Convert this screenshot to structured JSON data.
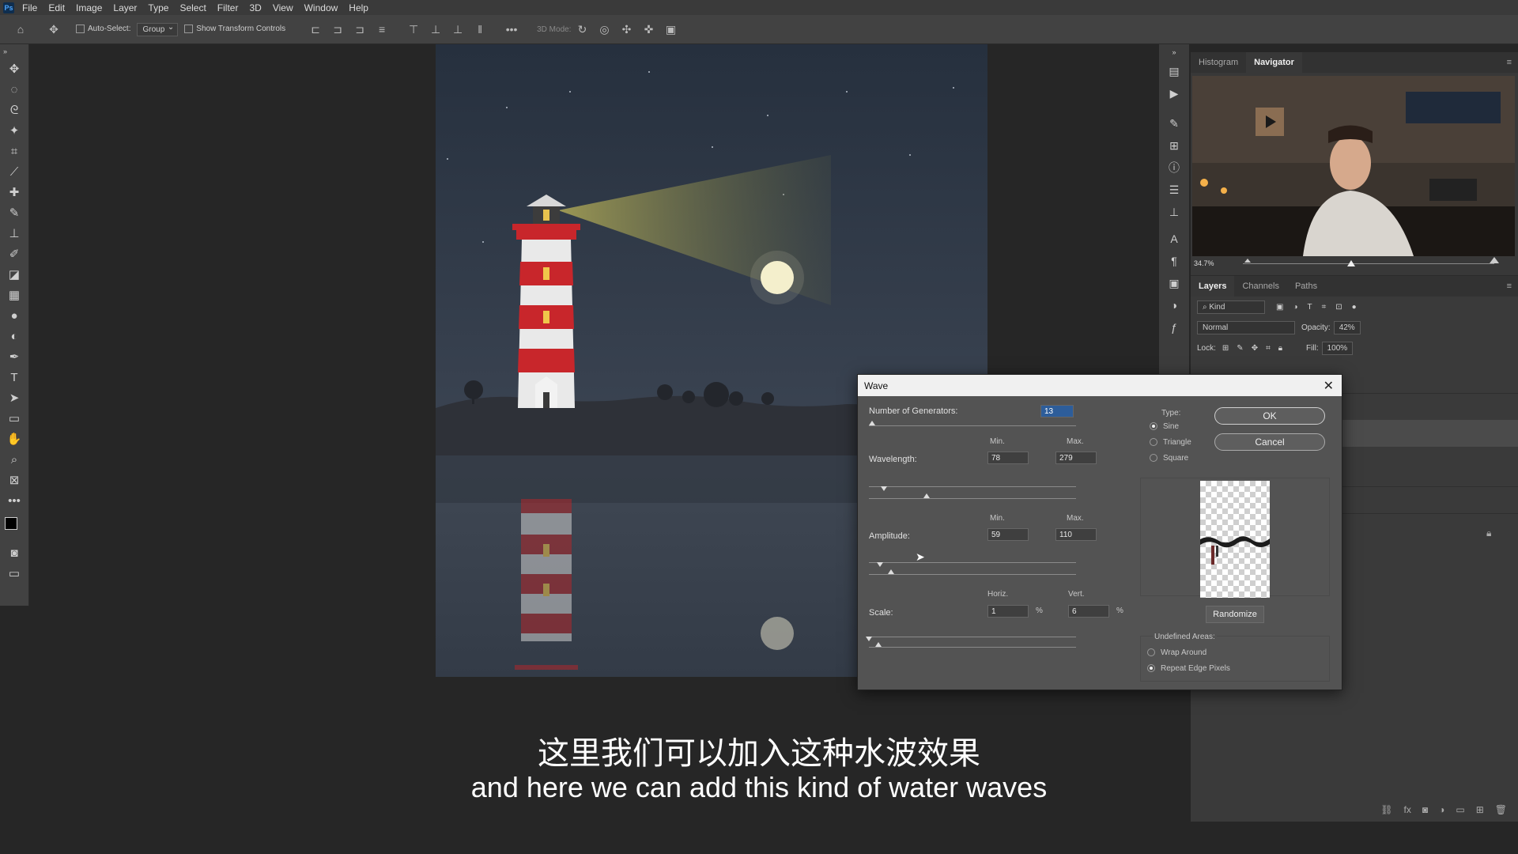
{
  "app": {
    "logo_text": "Ps"
  },
  "menu": [
    "File",
    "Edit",
    "Image",
    "Layer",
    "Type",
    "Select",
    "Filter",
    "3D",
    "View",
    "Window",
    "Help"
  ],
  "options_bar": {
    "auto_select_label": "Auto-Select:",
    "auto_select_value": "Group",
    "show_transform_label": "Show Transform Controls",
    "mode_label": "3D Mode:"
  },
  "navigator": {
    "tabs": [
      "Histogram",
      "Navigator"
    ],
    "active_tab": "Navigator",
    "zoom": "34.7%"
  },
  "layers": {
    "tabs": [
      "Layers",
      "Channels",
      "Paths"
    ],
    "active_tab": "Layers",
    "kind": "Kind",
    "blend_mode": "Normal",
    "opacity_label": "Opacity:",
    "opacity": "42%",
    "lock_label": "Lock:",
    "fill_label": "Fill:",
    "fill": "100%"
  },
  "wave_dialog": {
    "title": "Wave",
    "generators_label": "Number of Generators:",
    "generators_value": "13",
    "wavelength_label": "Wavelength:",
    "min_label": "Min.",
    "max_label": "Max.",
    "wavelength_min": "78",
    "wavelength_max": "279",
    "amplitude_label": "Amplitude:",
    "amplitude_min": "59",
    "amplitude_max": "110",
    "scale_label": "Scale:",
    "horiz_label": "Horiz.",
    "vert_label": "Vert.",
    "scale_horiz": "1",
    "scale_vert": "6",
    "percent": "%",
    "type_label": "Type:",
    "types": [
      "Sine",
      "Triangle",
      "Square"
    ],
    "selected_type": "Sine",
    "ok_label": "OK",
    "cancel_label": "Cancel",
    "randomize_label": "Randomize",
    "undefined_label": "Undefined Areas:",
    "undefined_options": [
      "Wrap Around",
      "Repeat Edge Pixels"
    ],
    "selected_undefined": "Repeat Edge Pixels"
  },
  "subtitles": {
    "cn": "这里我们可以加入这种水波效果",
    "en": "and here we can add this kind of water waves"
  },
  "colors": {
    "accent": "#4ea6ff",
    "lighthouse_red": "#c8262b",
    "sky": "#2c3442"
  }
}
